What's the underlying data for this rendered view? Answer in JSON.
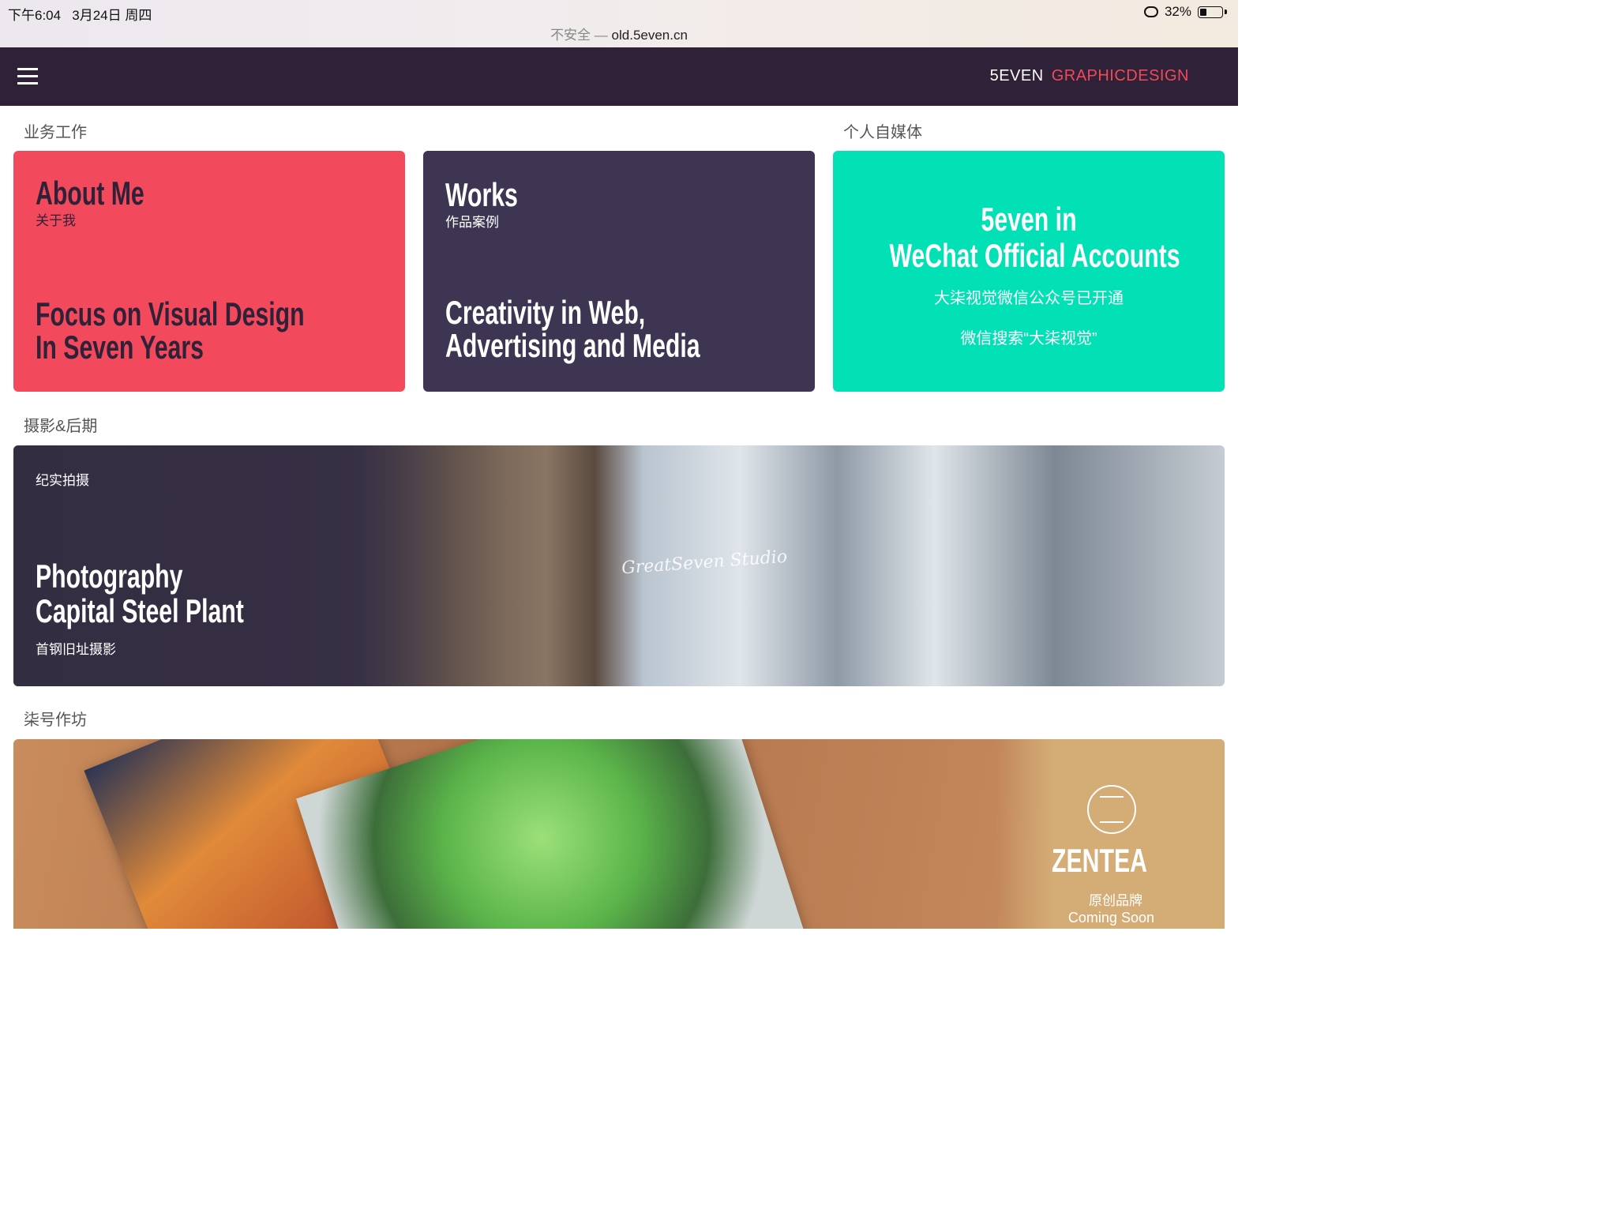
{
  "status": {
    "time": "下午6:04",
    "date": "3月24日 周四",
    "battery": "32%",
    "battery_level": 0.32
  },
  "url": {
    "insecure_label": "不安全",
    "separator": "—",
    "domain": "old.5even.cn"
  },
  "nav": {
    "brand_part1": "5EVEN",
    "brand_part2": "GRAPHICDESIGN",
    "brand_accent": "#f04a5a",
    "background": "#2f2137"
  },
  "sections": {
    "business": "业务工作",
    "media": "个人自媒体",
    "photo": "摄影&后期",
    "workshop": "柒号作坊"
  },
  "cards": {
    "about": {
      "title": "About Me",
      "subtitle": "关于我",
      "line1": "Focus on Visual Design",
      "line2": "In Seven Years",
      "color": "#f24a5c"
    },
    "works": {
      "title": "Works",
      "subtitle": "作品案例",
      "line1": "Creativity in Web,",
      "line2": "Advertising and Media",
      "color": "#3d3551"
    },
    "wechat": {
      "line1": "5even in",
      "line2": "WeChat Official Accounts",
      "line3": "大柒视觉微信公众号已开通",
      "line4": "微信搜索“大柒视觉”",
      "color": "#02e0b6"
    },
    "photo": {
      "tag": "纪实拍摄",
      "line1": "Photography",
      "line2": "Capital Steel Plant",
      "subtitle": "首钢旧址摄影",
      "watermark": "GreatSeven Studio"
    },
    "zentea": {
      "name": "ZENTEA",
      "subtitle": "原创品牌",
      "status": "Coming Soon"
    }
  }
}
